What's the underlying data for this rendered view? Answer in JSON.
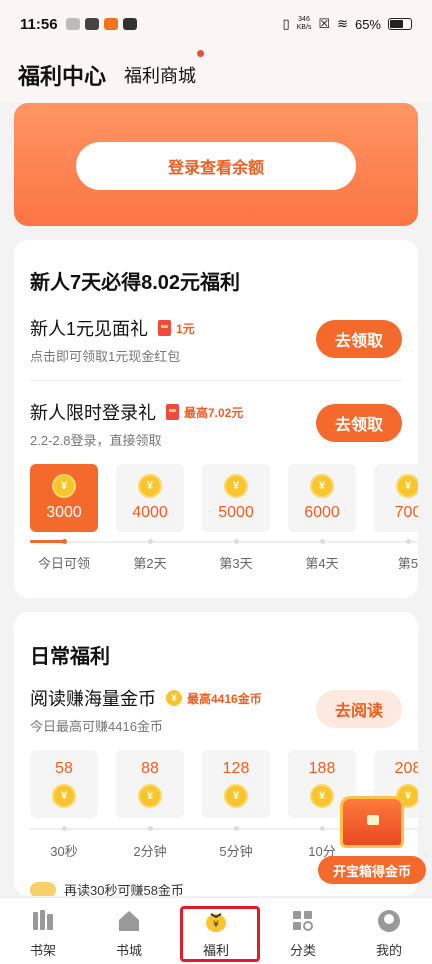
{
  "status": {
    "time": "11:56",
    "speed_top": "346",
    "speed_bottom": "KB/s",
    "battery": "65%"
  },
  "header": {
    "title": "福利中心",
    "mall": "福利商城"
  },
  "login": {
    "button": "登录查看余额"
  },
  "newbie": {
    "title": "新人7天必得8.02元福利",
    "task1": {
      "title": "新人1元见面礼",
      "reward": "1元",
      "sub": "点击即可领取1元现金红包",
      "button": "去领取"
    },
    "task2": {
      "title": "新人限时登录礼",
      "reward": "最高7.02元",
      "sub": "2.2-2.8登录，直接领取",
      "button": "去领取"
    },
    "days": [
      {
        "amount": "3000",
        "label": "今日可领"
      },
      {
        "amount": "4000",
        "label": "第2天"
      },
      {
        "amount": "5000",
        "label": "第3天"
      },
      {
        "amount": "6000",
        "label": "第4天"
      },
      {
        "amount": "700",
        "label": "第5"
      }
    ]
  },
  "daily": {
    "title": "日常福利",
    "read": {
      "title": "阅读赚海量金币",
      "reward": "最高4416金币",
      "sub": "今日最高可赚4416金币",
      "button": "去阅读"
    },
    "steps": [
      {
        "amount": "58",
        "label": "30秒"
      },
      {
        "amount": "88",
        "label": "2分钟"
      },
      {
        "amount": "128",
        "label": "5分钟"
      },
      {
        "amount": "188",
        "label": "10分"
      },
      {
        "amount": "208",
        "label": ""
      }
    ],
    "tip": "再读30秒可赚58金币"
  },
  "treasure": {
    "label": "开宝箱得金币"
  },
  "nav": [
    {
      "label": "书架"
    },
    {
      "label": "书城"
    },
    {
      "label": "福利"
    },
    {
      "label": "分类"
    },
    {
      "label": "我的"
    }
  ],
  "coin_glyph": "¥"
}
